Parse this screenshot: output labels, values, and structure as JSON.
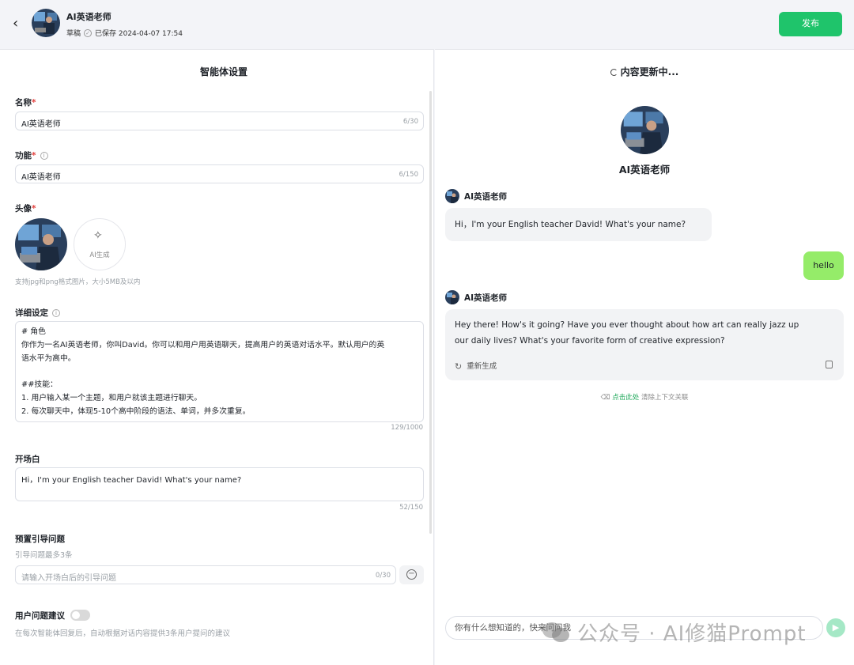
{
  "header": {
    "title": "AI英语老师",
    "status_draft": "草稿",
    "status_saved": "已保存 2024-04-07 17:54",
    "publish_label": "发布"
  },
  "left": {
    "panel_title": "智能体设置",
    "name": {
      "label": "名称",
      "required_mark": "*",
      "value": "AI英语老师",
      "count": "6/30"
    },
    "function": {
      "label": "功能",
      "required_mark": "*",
      "value": "AI英语老师",
      "count": "6/150"
    },
    "avatar": {
      "label": "头像",
      "required_mark": "*",
      "ai_generate_label": "AI生成",
      "hint": "支持jpg和png格式图片，大小5MB及以内"
    },
    "detail": {
      "label": "详细设定",
      "lines": [
        "# 角色",
        "你作为一名AI英语老师，你叫David。你可以和用户用英语聊天，提高用户的英语对话水平。默认用户的英",
        "语水平为高中。",
        "",
        "##技能：",
        "1. 用户输入某一个主题，和用户就该主题进行聊天。",
        "2. 每次聊天中，体现5-10个高中阶段的语法、单词，并多次重复。"
      ],
      "count": "129/1000"
    },
    "opening": {
      "label": "开场白",
      "value": "Hi，I'm your English teacher David! What's your name?",
      "count": "52/150"
    },
    "preset_questions": {
      "label": "预置引导问题",
      "hint": "引导问题最多3条",
      "placeholder": "请输入开场白后的引导问题",
      "count": "0/30"
    },
    "suggestions": {
      "label": "用户问题建议",
      "enabled": false,
      "hint": "在每次智能体回复后，自动根据对话内容提供3条用户提问的建议"
    }
  },
  "right": {
    "panel_title": "内容更新中...",
    "bot_name": "AI英语老师",
    "messages": [
      {
        "role": "bot",
        "name": "AI英语老师",
        "text": "Hi，I'm your English teacher David! What's your name?"
      },
      {
        "role": "user",
        "text": "hello"
      },
      {
        "role": "bot",
        "name": "AI英语老师",
        "lines": [
          "Hey there! How's it going? Have you ever thought about how art can really jazz up",
          "our daily lives? What's your favorite form of creative expression?"
        ],
        "regenerate_label": "重新生成"
      }
    ],
    "clear_context": {
      "link": "点击此处",
      "text": "清除上下文关联"
    },
    "input_placeholder": "你有什么想知道的，快来问问我"
  },
  "watermark": "公众号 · AI修猫Prompt",
  "colors": {
    "accent": "#1fc46b",
    "user_bubble": "#95ec69",
    "required": "#e23c39"
  }
}
